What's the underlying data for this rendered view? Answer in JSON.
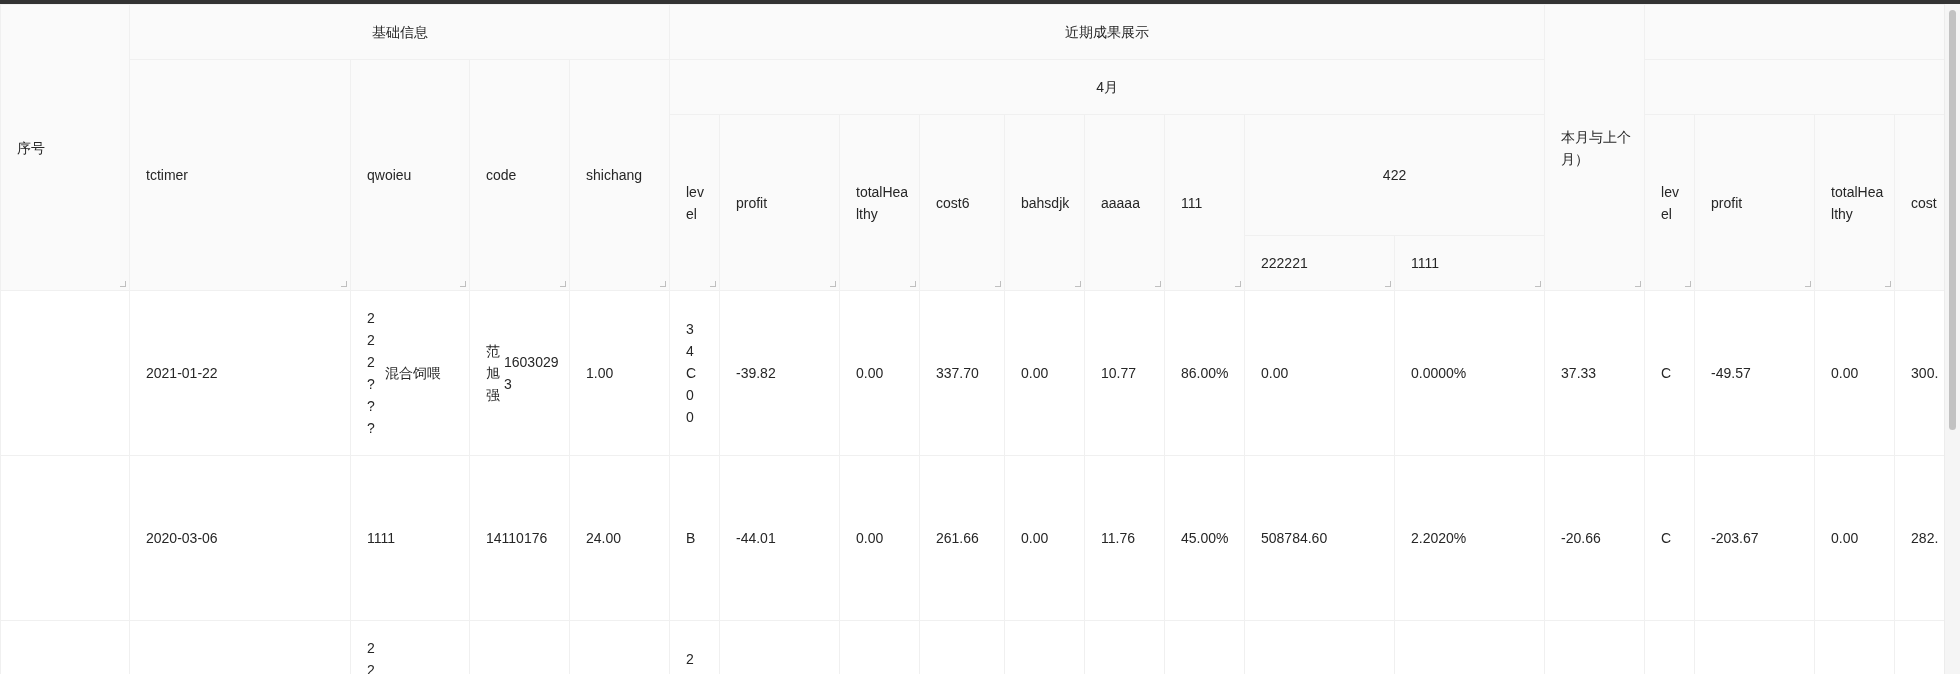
{
  "columns": [
    {
      "title": "序号"
    },
    {
      "title": "基础信息",
      "children": [
        {
          "title": "tctimer"
        },
        {
          "title": "qwoieu"
        },
        {
          "title": "code"
        },
        {
          "title": "shichang"
        }
      ]
    },
    {
      "title": "近期成果展示",
      "children": [
        {
          "title": "4月",
          "children": [
            {
              "title": "level"
            },
            {
              "title": "profit"
            },
            {
              "title": "totalHealthy"
            },
            {
              "title": "cost6"
            },
            {
              "title": "bahsdjk"
            },
            {
              "title": "aaaaa"
            },
            {
              "title": "111"
            },
            {
              "title": "422",
              "children": [
                {
                  "title": "222221"
                },
                {
                  "title": "1111"
                }
              ]
            }
          ]
        }
      ]
    },
    {
      "title": "本月与上个月）"
    },
    {
      "children": [
        {
          "children": [
            {
              "title": "level"
            },
            {
              "title": "profit"
            },
            {
              "title": "totalHealthy"
            },
            {
              "title": "cost"
            }
          ]
        }
      ]
    }
  ],
  "rows": [
    {
      "cells": [
        {},
        {
          "text": "2021-01-22"
        },
        {
          "vertical": "222???",
          "text": "混合饲喂"
        },
        {
          "vertical": "范旭强",
          "text": "16030293"
        },
        {
          "text": "1.00"
        },
        {
          "vertical": "34C00"
        },
        {
          "text": "-39.82"
        },
        {
          "text": "0.00"
        },
        {
          "text": "337.70"
        },
        {
          "text": "0.00"
        },
        {
          "text": "10.77"
        },
        {
          "text": "86.00%"
        },
        {
          "text": "0.00"
        },
        {
          "text": "0.0000%"
        },
        {
          "text": "37.33"
        },
        {
          "text": "C"
        },
        {
          "text": "-49.57"
        },
        {
          "text": "0.00"
        },
        {
          "text": "300."
        }
      ]
    },
    {
      "cells": [
        {},
        {
          "text": "2020-03-06"
        },
        {
          "text": "1111"
        },
        {
          "text": "14110176"
        },
        {
          "text": "24.00"
        },
        {
          "text": "B"
        },
        {
          "text": "-44.01"
        },
        {
          "text": "0.00"
        },
        {
          "text": "261.66"
        },
        {
          "text": "0.00"
        },
        {
          "text": "11.76"
        },
        {
          "text": "45.00%"
        },
        {
          "text": "508784.60"
        },
        {
          "text": "2.2020%"
        },
        {
          "text": "-20.66"
        },
        {
          "text": "C"
        },
        {
          "text": "-203.67"
        },
        {
          "text": "0.00"
        },
        {
          "text": "282."
        }
      ]
    },
    {
      "cells": [
        {},
        {},
        {
          "vertical": "22"
        },
        {},
        {},
        {
          "vertical": "2"
        },
        {},
        {},
        {},
        {},
        {},
        {},
        {},
        {},
        {},
        {},
        {},
        {},
        {}
      ]
    }
  ]
}
